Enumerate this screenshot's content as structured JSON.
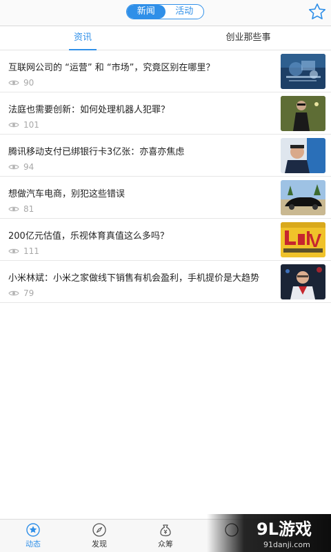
{
  "header": {
    "segments": [
      "新闻",
      "活动"
    ],
    "active_segment": 0,
    "favorite_icon": "star-outline-icon",
    "accent_color": "#2f8fe8"
  },
  "tabs": [
    "资讯",
    "创业那些事"
  ],
  "articles": [
    {
      "title": "互联网公司的 “运营” 和 “市场”，究竟区别在哪里？",
      "views": "90",
      "thumb_icon": "tech-network-image"
    },
    {
      "title": "法庭也需要创新：如何处理机器人犯罪？",
      "views": "101",
      "thumb_icon": "robot-man-image"
    },
    {
      "title": "腾讯移动支付已绑银行卡3亿张：亦喜亦焦虑",
      "views": "94",
      "thumb_icon": "speaker-portrait-image"
    },
    {
      "title": "想做汽车电商，别犯这些错误",
      "views": "81",
      "thumb_icon": "black-car-image"
    },
    {
      "title": "200亿元估值，乐视体育真值这么多吗？",
      "views": "111",
      "thumb_icon": "letv-sports-logo-image"
    },
    {
      "title": "小米林斌：小米之家做线下销售有机会盈利，手机提价是大趋势",
      "views": "79",
      "thumb_icon": "speaker-onstage-image"
    }
  ],
  "bottom_nav": [
    {
      "label": "动态",
      "icon": "star-circle-icon",
      "active": true
    },
    {
      "label": "发现",
      "icon": "compass-icon",
      "active": false
    },
    {
      "label": "众筹",
      "icon": "money-bag-icon",
      "active": false
    },
    {
      "label": "",
      "icon": "hidden-icon",
      "active": false
    },
    {
      "label": "",
      "icon": "hidden-icon",
      "active": false
    }
  ],
  "watermark": {
    "brand": "9L游戏",
    "url": "91danji.com"
  }
}
